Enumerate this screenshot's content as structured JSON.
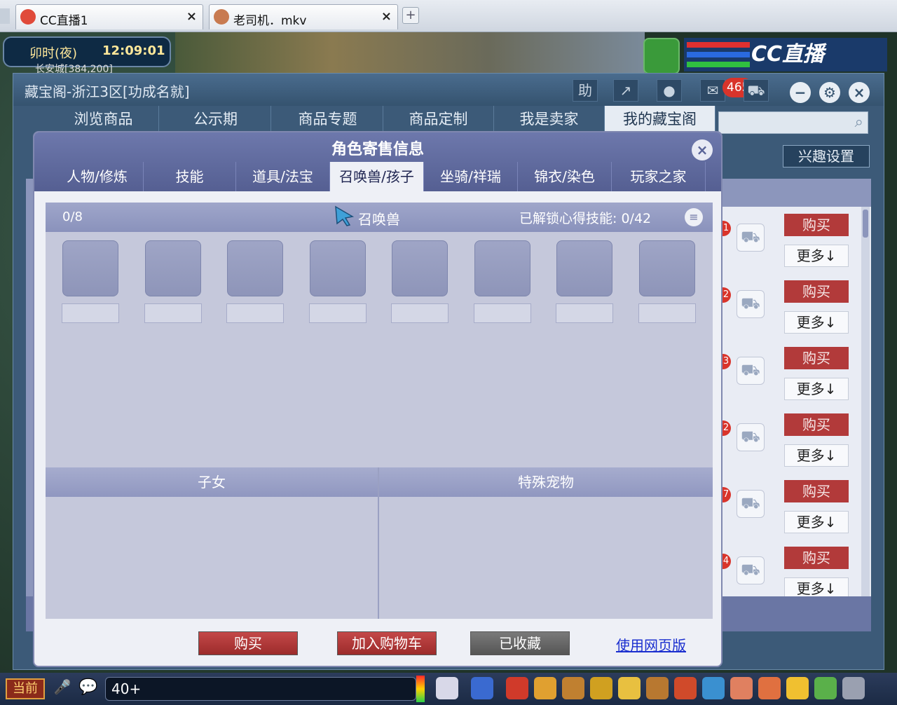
{
  "browser": {
    "tabs": [
      {
        "label": "CC直播1",
        "close": "×"
      },
      {
        "label": "老司机．mkv",
        "close": "×"
      }
    ],
    "new_tab": "+"
  },
  "hud": {
    "time_period": "卯时(夜)",
    "clock": "12:09:01",
    "location": "长安城[384,200]",
    "brand": "CC直播"
  },
  "window": {
    "title": "藏宝阁-浙江3区[功成名就]",
    "help": "助",
    "message_count": "465",
    "nav_tabs": [
      "浏览商品",
      "公示期",
      "商品专题",
      "商品定制",
      "我是卖家",
      "我的藏宝阁"
    ],
    "active_nav": 5,
    "interest_button": "兴趣设置",
    "list_rows": [
      {
        "num": "1",
        "buy": "购买",
        "more": "更多↓"
      },
      {
        "num": "2",
        "buy": "购买",
        "more": "更多↓"
      },
      {
        "num": "3",
        "buy": "购买",
        "more": "更多↓"
      },
      {
        "num": "2",
        "buy": "购买",
        "more": "更多↓"
      },
      {
        "num": "7",
        "buy": "购买",
        "more": "更多↓"
      },
      {
        "num": "4",
        "buy": "购买",
        "more": "更多↓"
      }
    ]
  },
  "dialog": {
    "title": "角色寄售信息",
    "close": "×",
    "tabs": [
      "人物/修炼",
      "技能",
      "道具/法宝",
      "召唤兽/孩子",
      "坐骑/祥瑞",
      "锦衣/染色",
      "玩家之家"
    ],
    "active_tab": 3,
    "pets": {
      "count": "0/8",
      "heading": "召唤兽",
      "skills_label": "已解锁心得技能:",
      "skills_value": "0/42",
      "slots": 8
    },
    "children_heading": "子女",
    "special_pets_heading": "特殊宠物",
    "buttons": {
      "buy": "购买",
      "add_cart": "加入购物车",
      "favorited": "已收藏",
      "web_version": "使用网页版"
    }
  },
  "bottom": {
    "channel": "当前",
    "input_value": "40+"
  },
  "colors": {
    "accent_red": "#b23a3a",
    "dialog_header": "#5f69a0",
    "window_header": "#3c5a78"
  }
}
